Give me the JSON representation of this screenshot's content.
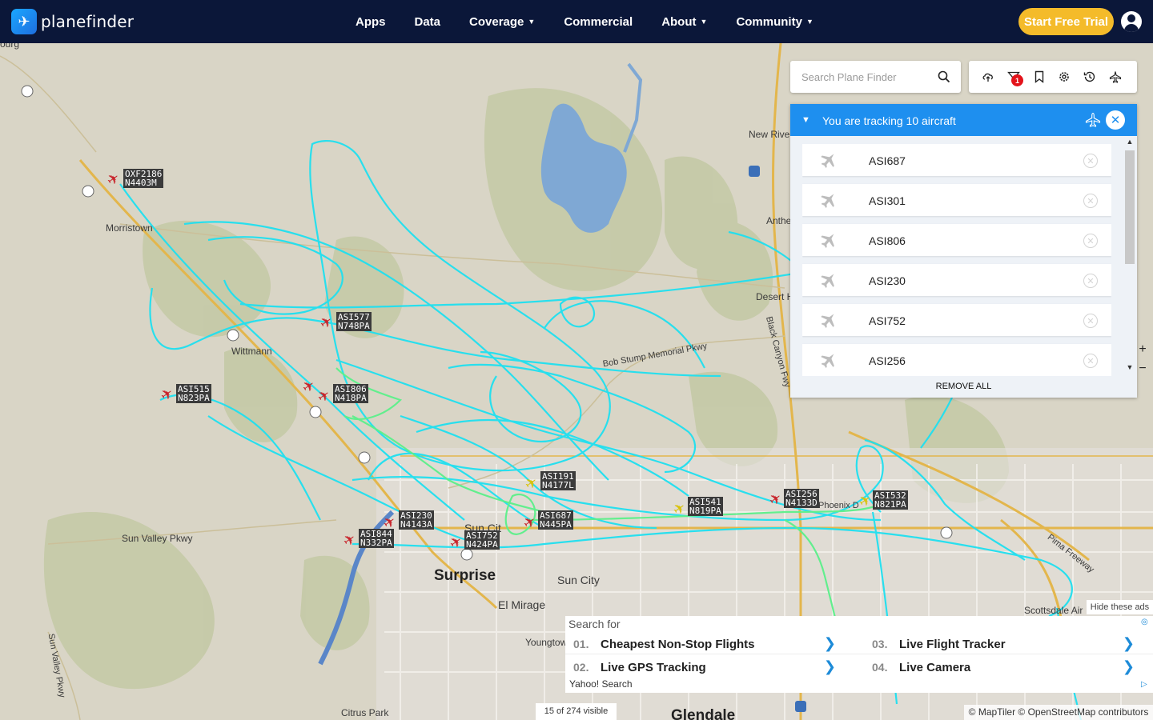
{
  "brand": {
    "name": "planefinder"
  },
  "nav": {
    "items": [
      {
        "label": "Apps",
        "has_menu": false
      },
      {
        "label": "Data",
        "has_menu": false
      },
      {
        "label": "Coverage",
        "has_menu": true
      },
      {
        "label": "Commercial",
        "has_menu": false
      },
      {
        "label": "About",
        "has_menu": true
      },
      {
        "label": "Community",
        "has_menu": true
      }
    ],
    "cta": "Start Free Trial",
    "account_icon": "user-circle-icon"
  },
  "search": {
    "placeholder": "Search Plane Finder",
    "value": ""
  },
  "toolbar": {
    "icons": [
      "upload-cloud-icon",
      "filter-icon",
      "bookmark-icon",
      "settings-gear-icon",
      "history-icon",
      "plane-settings-icon"
    ],
    "filter_badge": "1"
  },
  "tracking": {
    "title": "You are tracking 10 aircraft",
    "items": [
      "ASI687",
      "ASI301",
      "ASI806",
      "ASI230",
      "ASI752",
      "ASI256"
    ],
    "remove_all": "REMOVE ALL"
  },
  "map": {
    "places": [
      {
        "name": "ourg"
      },
      {
        "name": "Morristown"
      },
      {
        "name": "Wittmann"
      },
      {
        "name": "New River"
      },
      {
        "name": "Anthe"
      },
      {
        "name": "Desert H"
      },
      {
        "name": "Surprise"
      },
      {
        "name": "Sun City"
      },
      {
        "name": "Sun Cit"
      },
      {
        "name": "El Mirage"
      },
      {
        "name": "Youngtow"
      },
      {
        "name": "Citrus Park"
      },
      {
        "name": "Glendale"
      },
      {
        "name": "Sun Valley Pkwy"
      },
      {
        "name": "Scottsdale Air"
      },
      {
        "name": "Bob Stump Memorial Pkwy"
      },
      {
        "name": "Black Canyon Fwy"
      },
      {
        "name": "Pima Freeway"
      },
      {
        "name": "Sun Valley Pkwy"
      },
      {
        "name": "Phoenix D"
      }
    ],
    "aircraft": [
      {
        "callsign": "OXF2186",
        "reg": "N4403M",
        "color": "#c8242b"
      },
      {
        "callsign": "ASI577",
        "reg": "N748PA",
        "color": "#c8242b"
      },
      {
        "callsign": "ASI806",
        "reg": "N418PA",
        "color": "#c8242b"
      },
      {
        "callsign": "ASI515",
        "reg": "N823PA",
        "color": "#c8242b"
      },
      {
        "callsign": "ASI191",
        "reg": "N4177L",
        "color": "#d9c20b"
      },
      {
        "callsign": "ASI687",
        "reg": "N445PA",
        "color": "#c8242b"
      },
      {
        "callsign": "ASI541",
        "reg": "N819PA",
        "color": "#d9c20b"
      },
      {
        "callsign": "ASI256",
        "reg": "N4133D",
        "color": "#c8242b"
      },
      {
        "callsign": "ASI532",
        "reg": "N821PA",
        "color": "#d9c20b"
      },
      {
        "callsign": "ASI230",
        "reg": "N4143A",
        "color": "#c8242b"
      },
      {
        "callsign": "ASI844",
        "reg": "N332PA",
        "color": "#c8242b"
      },
      {
        "callsign": "ASI752",
        "reg": "N424PA",
        "color": "#c8242b"
      }
    ],
    "track_color": "#1fe0f0",
    "track_color_recent": "#5cf08a",
    "visible_count": "15 of 274 visible",
    "attribution": "© MapTiler © OpenStreetMap contributors",
    "zoom_in": "+",
    "zoom_out": "−"
  },
  "ad": {
    "hide_label": "Hide these ads",
    "search_for": "Search for",
    "items": [
      {
        "num": "01.",
        "text": "Cheapest Non-Stop Flights"
      },
      {
        "num": "03.",
        "text": "Live Flight Tracker"
      },
      {
        "num": "02.",
        "text": "Live GPS Tracking"
      },
      {
        "num": "04.",
        "text": "Live Camera"
      }
    ],
    "footer": "Yahoo! Search"
  }
}
